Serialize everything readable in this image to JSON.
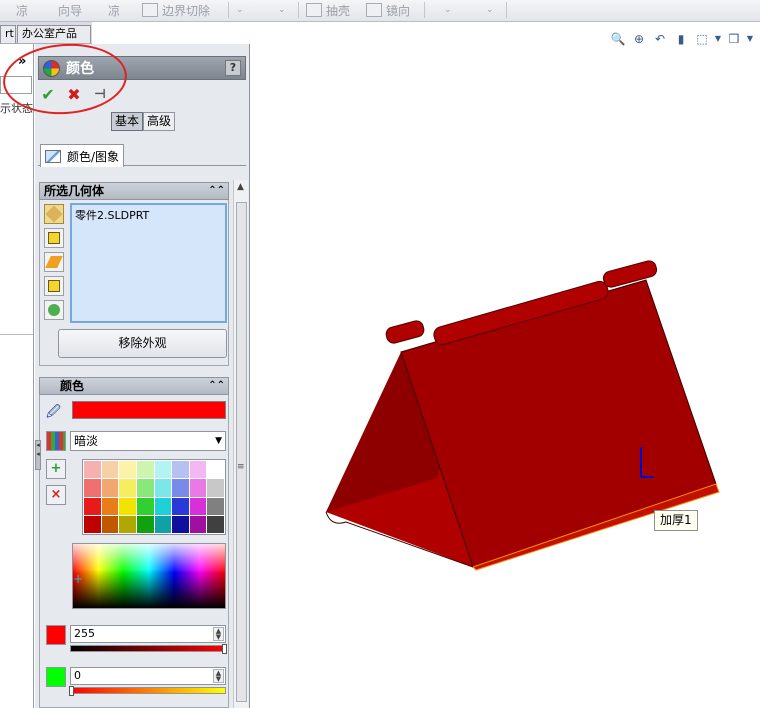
{
  "toolbar": {
    "items": [
      "边界切除",
      "抽壳",
      "镜向"
    ],
    "faded": [
      "凉",
      "向导",
      "凉"
    ]
  },
  "doc_tabs": [
    "rt",
    "办公室产品"
  ],
  "left_strip": {
    "chevron": "»",
    "text": "示状态"
  },
  "pm": {
    "title": "颜色",
    "help": "?",
    "ok": "✔",
    "cancel": "✖",
    "pin": "⊣",
    "modes": [
      "基本",
      "高级"
    ],
    "tab": "颜色/图象"
  },
  "geometry_section": {
    "header": "所选几何体",
    "items": [
      "零件2.SLDPRT"
    ],
    "remove_button": "移除外观"
  },
  "color_section": {
    "header": "颜色",
    "current_color": "#ff0000",
    "palette_dropdown": "暗淡",
    "swatches": [
      "#f7b0b0",
      "#f7d0a8",
      "#fbf4a8",
      "#cdf5b0",
      "#b3f3f3",
      "#b7c0f3",
      "#f3b7f3",
      "#ffffff",
      "#f07070",
      "#f0a870",
      "#f6ee60",
      "#8ae87a",
      "#7ae8ea",
      "#7a8ae8",
      "#e87ae8",
      "#c8c8c8",
      "#e81a1a",
      "#e87e1a",
      "#f0e400",
      "#30d030",
      "#20d0d8",
      "#2a3ad8",
      "#d830d8",
      "#808080",
      "#c00000",
      "#c05800",
      "#b0a800",
      "#10a010",
      "#10a0a8",
      "#1010a0",
      "#a010a0",
      "#404040"
    ],
    "channels": [
      {
        "color": "#ff0000",
        "value": "255"
      },
      {
        "color": "#00ff00",
        "value": "0"
      }
    ]
  },
  "viewport": {
    "callout": "加厚1",
    "tools": [
      "zoom-fit-icon",
      "zoom-area-icon",
      "previous-view-icon",
      "section-view-icon",
      "view-orientation-icon",
      "display-style-icon"
    ]
  }
}
